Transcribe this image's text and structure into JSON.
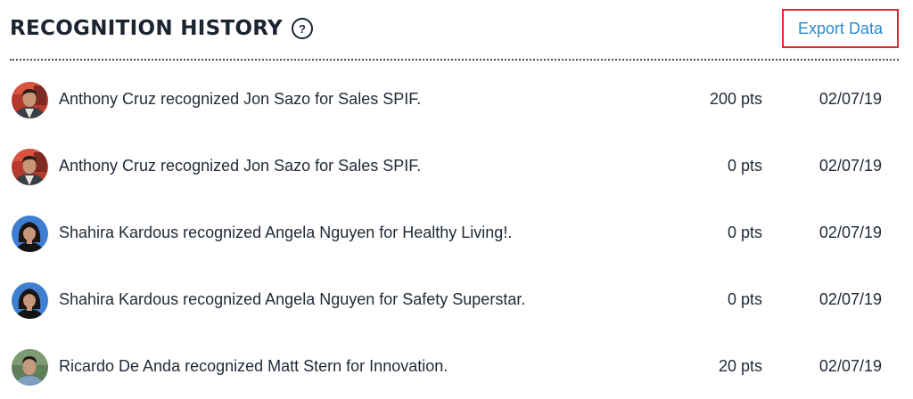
{
  "header": {
    "title": "RECOGNITION HISTORY",
    "help_symbol": "?",
    "export_label": "Export Data",
    "export_highlight_color": "#e0232e",
    "link_color": "#2a8bd0"
  },
  "rows": [
    {
      "avatar_icon": "avatar-man-dark-hair",
      "text": "Anthony Cruz recognized Jon Sazo for Sales SPIF.",
      "points": "200 pts",
      "date": "02/07/19"
    },
    {
      "avatar_icon": "avatar-man-dark-hair",
      "text": "Anthony Cruz recognized Jon Sazo for Sales SPIF.",
      "points": "0 pts",
      "date": "02/07/19"
    },
    {
      "avatar_icon": "avatar-woman-dark-hair",
      "text": "Shahira Kardous recognized Angela Nguyen for Healthy Living!.",
      "points": "0 pts",
      "date": "02/07/19"
    },
    {
      "avatar_icon": "avatar-woman-dark-hair",
      "text": "Shahira Kardous recognized Angela Nguyen for Safety Superstar.",
      "points": "0 pts",
      "date": "02/07/19"
    },
    {
      "avatar_icon": "avatar-man-short-hair",
      "text": "Ricardo De Anda recognized Matt Stern for Innovation.",
      "points": "20 pts",
      "date": "02/07/19"
    }
  ]
}
